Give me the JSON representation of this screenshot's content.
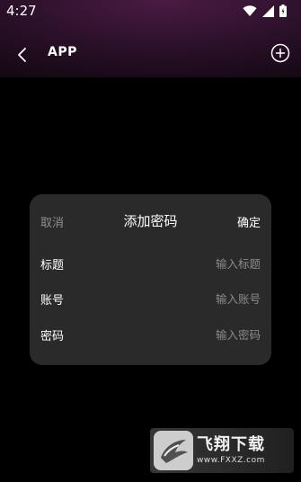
{
  "status": {
    "time": "4:27"
  },
  "nav": {
    "title": "APP"
  },
  "dialog": {
    "cancel": "取消",
    "title": "添加密码",
    "confirm": "确定",
    "fields": [
      {
        "label": "标题",
        "placeholder": "输入标题"
      },
      {
        "label": "账号",
        "placeholder": "输入账号"
      },
      {
        "label": "密码",
        "placeholder": "输入密码"
      }
    ]
  },
  "watermark": {
    "name": "飞翔下载",
    "url": "www.FXXZ.com"
  }
}
